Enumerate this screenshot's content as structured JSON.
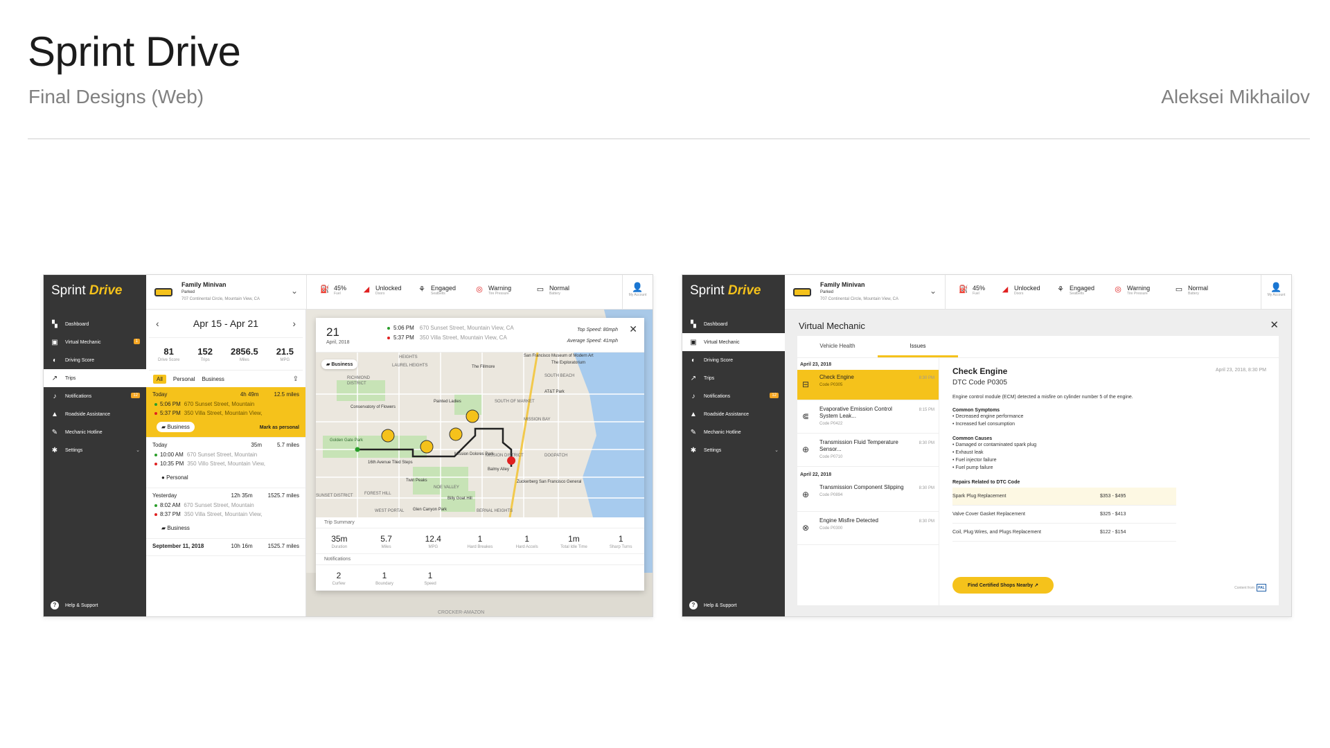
{
  "header": {
    "title": "Sprint Drive",
    "subtitle": "Final Designs (Web)",
    "author": "Aleksei Mikhailov"
  },
  "app": {
    "logo_a": "Sprint",
    "logo_b": "Drive",
    "nav": [
      {
        "label": "Dashboard",
        "icon": "map-icon"
      },
      {
        "label": "Virtual Mechanic",
        "icon": "chart-icon",
        "badge": "1"
      },
      {
        "label": "Driving Score",
        "icon": "score-icon"
      },
      {
        "label": "Trips",
        "icon": "trend-icon"
      },
      {
        "label": "Notifications",
        "icon": "bell-icon",
        "badge": "12"
      },
      {
        "label": "Roadside Assistance",
        "icon": "road-icon"
      },
      {
        "label": "Mechanic Hotline",
        "icon": "wrench-icon"
      },
      {
        "label": "Settings",
        "icon": "gear-icon"
      }
    ],
    "help": "Help & Support",
    "vehicle": {
      "name": "Family Minivan",
      "status": "Parked",
      "address": "707 Continental Circle, Mountain View, CA"
    },
    "stats": [
      {
        "value": "45%",
        "label": "Fuel",
        "icon": "fuel-icon"
      },
      {
        "value": "Unlocked",
        "label": "Doors",
        "icon": "door-icon"
      },
      {
        "value": "Engaged",
        "label": "Seatbelts",
        "icon": "seatbelt-icon"
      },
      {
        "value": "Warning",
        "label": "Tire Pressure",
        "icon": "tire-icon"
      },
      {
        "value": "Normal",
        "label": "Battery",
        "icon": "battery-icon"
      }
    ],
    "account": "My Account"
  },
  "screen1": {
    "range": "Apr 15 - Apr 21",
    "summary": [
      {
        "n": "81",
        "l": "Drive Score"
      },
      {
        "n": "152",
        "l": "Trips"
      },
      {
        "n": "2856.5",
        "l": "Miles"
      },
      {
        "n": "21.5",
        "l": "MPG"
      }
    ],
    "filters": [
      "All",
      "Personal",
      "Business"
    ],
    "trips": [
      {
        "day": "Today",
        "dur": "4h 49m",
        "miles": "12.5 miles",
        "t1": "5:06 PM",
        "a1": "670 Sunset Street, Mountain",
        "t2": "5:37 PM",
        "a2": "350 Villa Street, Mountain View,",
        "tag": "Business",
        "mark": "Mark as personal"
      },
      {
        "day": "Today",
        "dur": "35m",
        "miles": "5.7 miles",
        "t1": "10:00 AM",
        "a1": "670 Sunset Street, Mountain",
        "t2": "10:35 PM",
        "a2": "350 Villo Street, Mountain View,",
        "tag": "Personal"
      },
      {
        "day": "Yesterday",
        "dur": "12h 35m",
        "miles": "1525.7 miles",
        "t1": "8:02 AM",
        "a1": "670 Sunset Street, Mountain",
        "t2": "8:37 PM",
        "a2": "350 Villa Street, Mountain View,",
        "tag": "Business"
      },
      {
        "day": "September 11, 2018",
        "dur": "10h 16m",
        "miles": "1525.7 miles"
      }
    ],
    "card": {
      "day": "21",
      "month": "April, 2018",
      "t1": "5:06 PM",
      "a1": "670 Sunset Street, Mountain View, CA",
      "t2": "5:37 PM",
      "a2": "350 Villa Street, Mountain View, CA",
      "top_speed": "Top Speed: 80mph",
      "avg_speed": "Average Speed: 41mph",
      "chip": "Business",
      "summary_title": "Trip Summary",
      "summary": [
        {
          "n": "35m",
          "l": "Duration"
        },
        {
          "n": "5.7",
          "l": "Miles"
        },
        {
          "n": "12.4",
          "l": "MPG"
        },
        {
          "n": "1",
          "l": "Hard Breakes"
        },
        {
          "n": "1",
          "l": "Hard Accels"
        },
        {
          "n": "1m",
          "l": "Total Idle Time"
        },
        {
          "n": "1",
          "l": "Sharp Turns"
        }
      ],
      "notif_title": "Notifications",
      "notifs": [
        {
          "n": "2",
          "l": "Curfew"
        },
        {
          "n": "1",
          "l": "Boundary"
        },
        {
          "n": "1",
          "l": "Speed"
        }
      ],
      "map_labels": [
        "RICHMOND",
        "DISTRICT",
        "Golden Gate Park",
        "The Fillmore",
        "Painted Ladies",
        "Conservatory of Flowers",
        "AT&T Park",
        "SOUTH OF MARKET",
        "MISSION BAY",
        "MISSION DISTRICT",
        "Balmy Alley",
        "Twin Peaks",
        "NOE VALLEY",
        "Billy Goat Hill",
        "Glen Canyon Park",
        "BERNAL HEIGHTS",
        "FOREST HILL",
        "SUNSET DISTRICT",
        "WEST PORTAL",
        "Mission Dolores Park",
        "16th Avenue Tiled Steps",
        "DOGPATCH",
        "CROCKER-AMAZON",
        "HEIGHTS",
        "LAUREL HEIGHTS",
        "SOUTH BEACH",
        "San Francisco Museum of Modern Art",
        "The Exploratorium",
        "Zuckerberg San Francisco General"
      ]
    }
  },
  "screen2": {
    "title": "Virtual Mechanic",
    "tabs": [
      "Vehicle Health",
      "Issues"
    ],
    "groups": [
      {
        "date": "April 23, 2018",
        "items": [
          {
            "title": "Check Engine",
            "code": "Code P0305",
            "time": "8:30 PM",
            "icon": "engine-icon"
          },
          {
            "title": "Evaporative Emission Control System Leak...",
            "code": "Code P0422",
            "time": "8:15 PM",
            "icon": "exhaust-icon"
          },
          {
            "title": "Transmission Fluid Temperature Sensor...",
            "code": "Code P0710",
            "time": "8:30 PM",
            "icon": "transmission-icon"
          }
        ]
      },
      {
        "date": "April 22, 2018",
        "items": [
          {
            "title": "Transmission Component Slipping",
            "code": "Code P0894",
            "time": "8:30 PM",
            "icon": "transmission-icon"
          },
          {
            "title": "Engine Misfire Detected",
            "code": "Code P0300",
            "time": "8:30 PM",
            "icon": "misfire-icon"
          }
        ]
      }
    ],
    "detail": {
      "title": "Check Engine",
      "date": "April 23, 2018, 8:30 PM",
      "code": "DTC Code P0305",
      "desc": "Engine control module (ECM) detected a misfire on cylinder number 5 of the engine.",
      "symptoms_h": "Common Symptoms",
      "symptoms": [
        "• Decreased engine performance",
        "• Increased fuel consumption"
      ],
      "causes_h": "Common Causes",
      "causes": [
        "• Damaged or contaminated spark plug",
        "• Exhaust leak",
        "• Fuel injector failure",
        "• Fuel pump failure"
      ],
      "repairs_h": "Repairs Related to DTC Code",
      "repairs": [
        {
          "name": "Spark Plug Replacement",
          "price": "$353 - $495"
        },
        {
          "name": "Valve Cover Gasket Replacement",
          "price": "$325 - $413"
        },
        {
          "name": "Coil, Plug Wires, and Plugs Replacement",
          "price": "$122 - $154"
        }
      ],
      "button": "Find Certified Shops Nearby",
      "credit": "Content from",
      "credit_logo": "PAL"
    }
  }
}
